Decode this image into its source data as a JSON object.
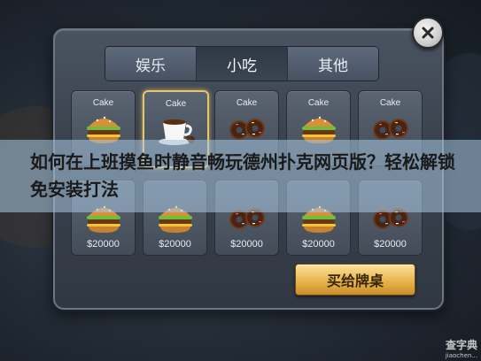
{
  "tabs": [
    {
      "label": "娱乐",
      "active": false
    },
    {
      "label": "小吃",
      "active": true
    },
    {
      "label": "其他",
      "active": false
    }
  ],
  "items": [
    {
      "name": "Cake",
      "price": "",
      "icon": "burger-icon",
      "selected": false
    },
    {
      "name": "Cake",
      "price": "",
      "icon": "coffee-cup-icon",
      "selected": true
    },
    {
      "name": "Cake",
      "price": "",
      "icon": "donut-icon",
      "selected": false
    },
    {
      "name": "Cake",
      "price": "",
      "icon": "burger-icon",
      "selected": false
    },
    {
      "name": "Cake",
      "price": "",
      "icon": "donut-icon",
      "selected": false
    },
    {
      "name": "",
      "price": "$20000",
      "icon": "burger-icon",
      "selected": false
    },
    {
      "name": "",
      "price": "$20000",
      "icon": "burger-icon",
      "selected": false
    },
    {
      "name": "",
      "price": "$20000",
      "icon": "donut-icon",
      "selected": false
    },
    {
      "name": "",
      "price": "$20000",
      "icon": "burger-icon",
      "selected": false
    },
    {
      "name": "",
      "price": "$20000",
      "icon": "donut-icon",
      "selected": false
    }
  ],
  "buy_button": {
    "label": "买给牌桌"
  },
  "banner": {
    "title": "如何在上班摸鱼时静音畅玩德州扑克网页版？轻松解锁免安装打法"
  },
  "watermark": {
    "main": "查字典",
    "sub": "jiaochen..."
  },
  "colors": {
    "accent_gold": "#e7c569",
    "panel": "#3a424d",
    "banner": "#aac8e1"
  }
}
